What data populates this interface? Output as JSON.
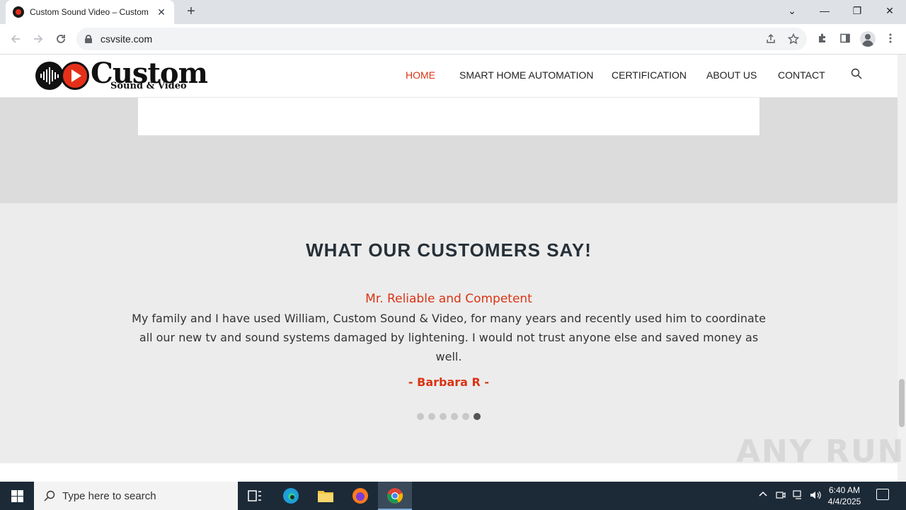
{
  "browser": {
    "tab_title": "Custom Sound Video – Custom",
    "tab_close": "✕",
    "new_tab": "+",
    "url": "csvsite.com",
    "window_controls": {
      "dropdown": "⌄",
      "minimize": "—",
      "restore": "❐",
      "close": "✕"
    }
  },
  "site": {
    "logo": {
      "big": "Custom",
      "small": "Sound & Video"
    },
    "nav": [
      {
        "label": "HOME",
        "active": true
      },
      {
        "label": "SMART HOME AUTOMATION",
        "active": false
      },
      {
        "label": "CERTIFICATION",
        "active": false
      },
      {
        "label": "ABOUT US",
        "active": false
      },
      {
        "label": "CONTACT",
        "active": false
      }
    ],
    "accent_color": "#d93415"
  },
  "testimonials": {
    "section_title": "WHAT OUR CUSTOMERS SAY!",
    "headline": "Mr. Reliable and Competent",
    "body": "My family and I have used William, Custom Sound & Video, for many years and recently used him to coordinate all our new tv and sound systems damaged by lightening. I would not trust anyone else and saved money as well.",
    "author": "- Barbara R -",
    "slide_count": 6,
    "active_slide": 6
  },
  "watermark": "ANY RUN",
  "taskbar": {
    "search_placeholder": "Type here to search",
    "time": "6:40 AM",
    "date": "4/4/2025"
  }
}
